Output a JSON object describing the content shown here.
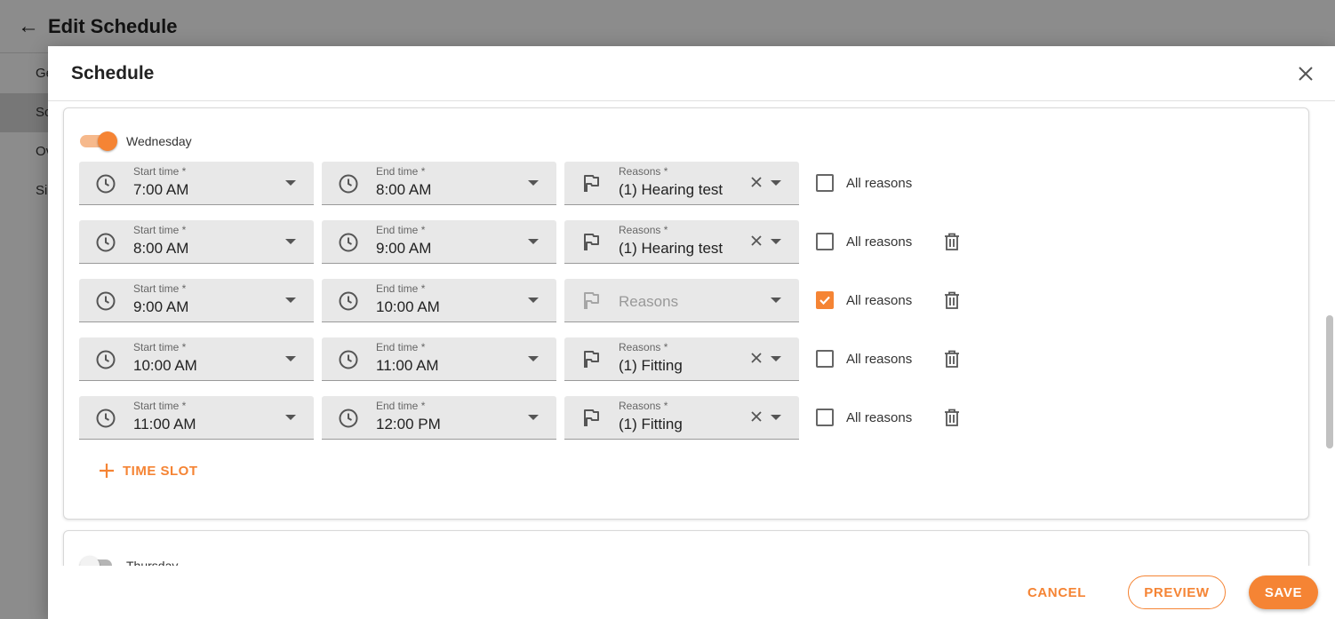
{
  "page": {
    "title": "Edit Schedule",
    "nav_items": [
      "Ge",
      "Sc",
      "Ov",
      "Si"
    ]
  },
  "modal": {
    "title": "Schedule",
    "wednesday": {
      "label": "Wednesday",
      "enabled": true,
      "slots": [
        {
          "start_label": "Start time *",
          "start": "7:00 AM",
          "end_label": "End time *",
          "end": "8:00 AM",
          "reasons_label": "Reasons *",
          "reasons": "(1) Hearing test",
          "all_reasons": false,
          "deletable": false
        },
        {
          "start_label": "Start time *",
          "start": "8:00 AM",
          "end_label": "End time *",
          "end": "9:00 AM",
          "reasons_label": "Reasons *",
          "reasons": "(1) Hearing test",
          "all_reasons": false,
          "deletable": true
        },
        {
          "start_label": "Start time *",
          "start": "9:00 AM",
          "end_label": "End time *",
          "end": "10:00 AM",
          "reasons_placeholder": "Reasons",
          "all_reasons": true,
          "deletable": true
        },
        {
          "start_label": "Start time *",
          "start": "10:00 AM",
          "end_label": "End time *",
          "end": "11:00 AM",
          "reasons_label": "Reasons *",
          "reasons": "(1) Fitting",
          "all_reasons": false,
          "deletable": true
        },
        {
          "start_label": "Start time *",
          "start": "11:00 AM",
          "end_label": "End time *",
          "end": "12:00 PM",
          "reasons_label": "Reasons *",
          "reasons": "(1) Fitting",
          "all_reasons": false,
          "deletable": true
        }
      ],
      "all_reasons_label": "All reasons",
      "add_slot_label": "TIME SLOT"
    },
    "thursday": {
      "label": "Thursday",
      "enabled": false
    },
    "footer": {
      "cancel": "CANCEL",
      "preview": "PREVIEW",
      "save": "SAVE"
    }
  },
  "colors": {
    "accent": "#f58434",
    "field_bg": "#e8e8e8"
  },
  "icons": {
    "back": "arrow-left-icon",
    "close": "close-icon",
    "clock": "clock-icon",
    "flag": "flag-icon",
    "clear": "clear-icon",
    "dropdown": "caret-down-icon",
    "trash": "trash-icon",
    "add": "plus-icon"
  }
}
